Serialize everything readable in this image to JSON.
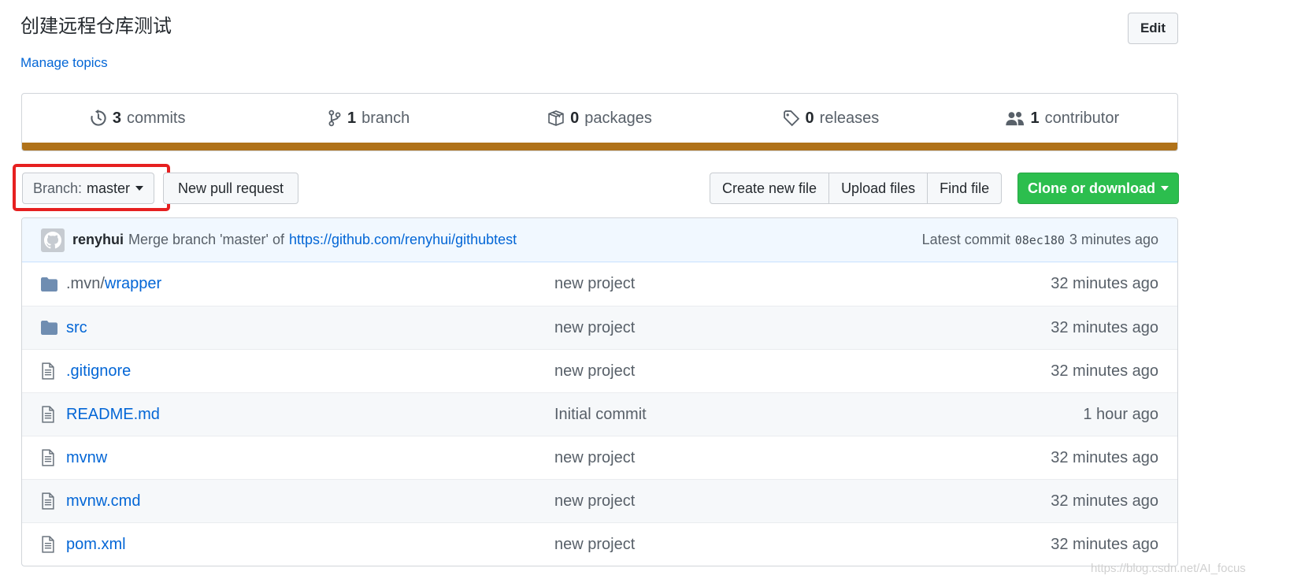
{
  "repo": {
    "title": "创建远程仓库测试",
    "edit_label": "Edit",
    "manage_topics": "Manage topics"
  },
  "summary": {
    "commits_count": "3",
    "commits_label": "commits",
    "branches_count": "1",
    "branches_label": "branch",
    "packages_count": "0",
    "packages_label": "packages",
    "releases_count": "0",
    "releases_label": "releases",
    "contributors_count": "1",
    "contributors_label": "contributor",
    "language_color": "#b07219"
  },
  "toolbar": {
    "branch_label": "Branch:",
    "branch_value": "master",
    "new_pull_request": "New pull request",
    "create_new_file": "Create new file",
    "upload_files": "Upload files",
    "find_file": "Find file",
    "clone_or_download": "Clone or download",
    "clone_color": "#2cbe4e"
  },
  "commit": {
    "author": "renyhui",
    "message": "Merge branch 'master' of",
    "link": "https://github.com/renyhui/githubtest",
    "latest_label": "Latest commit",
    "sha": "08ec180",
    "time": "3 minutes ago"
  },
  "files": [
    {
      "icon": "folder-icon",
      "prefix": ".mvn/",
      "name": "wrapper",
      "message": "new project",
      "age": "32 minutes ago"
    },
    {
      "icon": "folder-icon",
      "prefix": "",
      "name": "src",
      "message": "new project",
      "age": "32 minutes ago"
    },
    {
      "icon": "file-icon",
      "prefix": "",
      "name": ".gitignore",
      "message": "new project",
      "age": "32 minutes ago"
    },
    {
      "icon": "file-icon",
      "prefix": "",
      "name": "README.md",
      "message": "Initial commit",
      "age": "1 hour ago"
    },
    {
      "icon": "file-icon",
      "prefix": "",
      "name": "mvnw",
      "message": "new project",
      "age": "32 minutes ago"
    },
    {
      "icon": "file-icon",
      "prefix": "",
      "name": "mvnw.cmd",
      "message": "new project",
      "age": "32 minutes ago"
    },
    {
      "icon": "file-icon",
      "prefix": "",
      "name": "pom.xml",
      "message": "new project",
      "age": "32 minutes ago"
    }
  ],
  "watermark": "https://blog.csdn.net/AI_focus"
}
